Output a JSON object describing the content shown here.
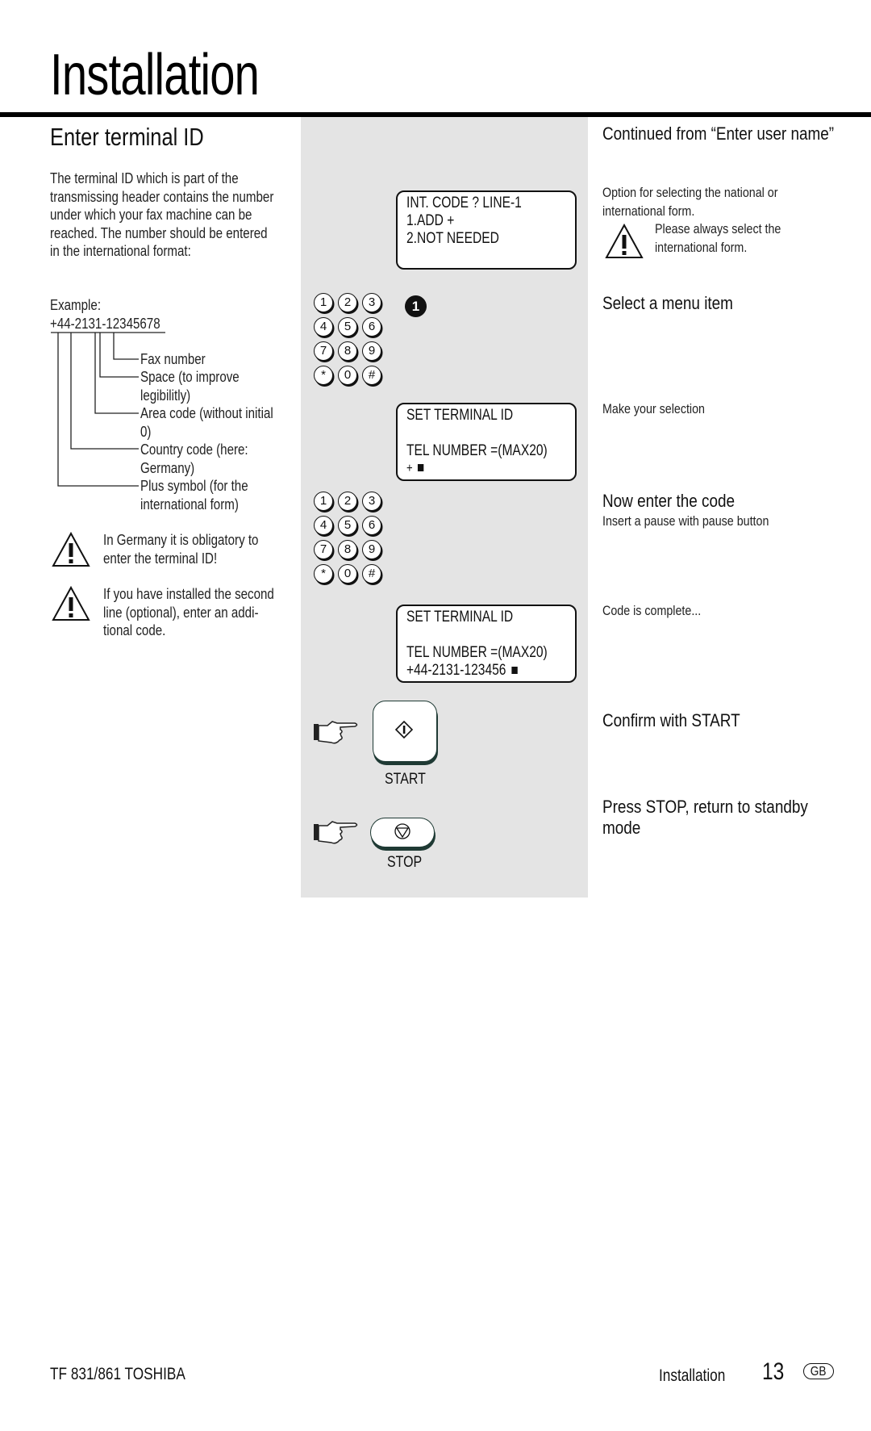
{
  "page": {
    "title": "Installation",
    "section_heading": "Enter terminal ID"
  },
  "left": {
    "intro_lines": [
      "The terminal ID which is part of the",
      "transmissing header contains the number",
      "under which your fax machine can be",
      "reached. The number should be entered",
      "in the international format:"
    ],
    "example_label": "Example:",
    "example_number": "+44-2131-12345678",
    "callouts": [
      {
        "lines": [
          "Fax number"
        ]
      },
      {
        "lines": [
          "Space  (to improve",
          "legibilitly)"
        ]
      },
      {
        "lines": [
          "Area code (without initial",
          "0)"
        ]
      },
      {
        "lines": [
          "Country code (here:",
          "Germany)"
        ]
      },
      {
        "lines": [
          "Plus symbol (for the",
          "international form)"
        ]
      }
    ],
    "warnings": [
      {
        "icon": "warning-triangle-icon",
        "lines": [
          "In Germany it is obligatory to",
          "enter the terminal ID!"
        ]
      },
      {
        "icon": "warning-triangle-icon",
        "lines": [
          "If you have installed the second",
          "line (optional), enter an addi-",
          "tional code."
        ]
      }
    ]
  },
  "middle": {
    "lcd_screens": [
      {
        "lines": [
          "INT. CODE ?   LINE-1",
          "1.ADD +",
          "2.NOT NEEDED",
          ""
        ]
      },
      {
        "lines": [
          "SET TERMINAL ID",
          "",
          "TEL NUMBER =(MAX20)",
          "+"
        ],
        "cursor": true
      },
      {
        "lines": [
          "SET TERMINAL ID",
          "",
          "TEL NUMBER =(MAX20)",
          "+44-2131-123456"
        ],
        "cursor": true
      }
    ],
    "keypad_keys": [
      "1",
      "2",
      "3",
      "4",
      "5",
      "6",
      "7",
      "8",
      "9",
      "*",
      "0",
      "#"
    ],
    "step_badge": "1",
    "start_label": "START",
    "stop_label": "STOP"
  },
  "right": {
    "continued": "Continued from “Enter user name”",
    "option_text": [
      "Option for selecting the national or",
      "international form."
    ],
    "option_warning": [
      "Please always select the",
      "international form."
    ],
    "select_menu": "Select a menu item",
    "make_selection": "Make your selection",
    "enter_code": "Now enter the code",
    "pause_hint": "Insert a pause with pause button",
    "code_complete": "Code is complete...",
    "confirm_start": "Confirm with START",
    "press_stop": [
      "Press STOP, return to standby",
      "mode"
    ]
  },
  "footer": {
    "model": "TF 831/861 TOSHIBA",
    "section": "Installation",
    "page_number": "13",
    "language": "GB"
  },
  "colors": {
    "panel_grey": "#e4e4e4",
    "rule": "#000000",
    "button_outline": "#1f3a34"
  }
}
